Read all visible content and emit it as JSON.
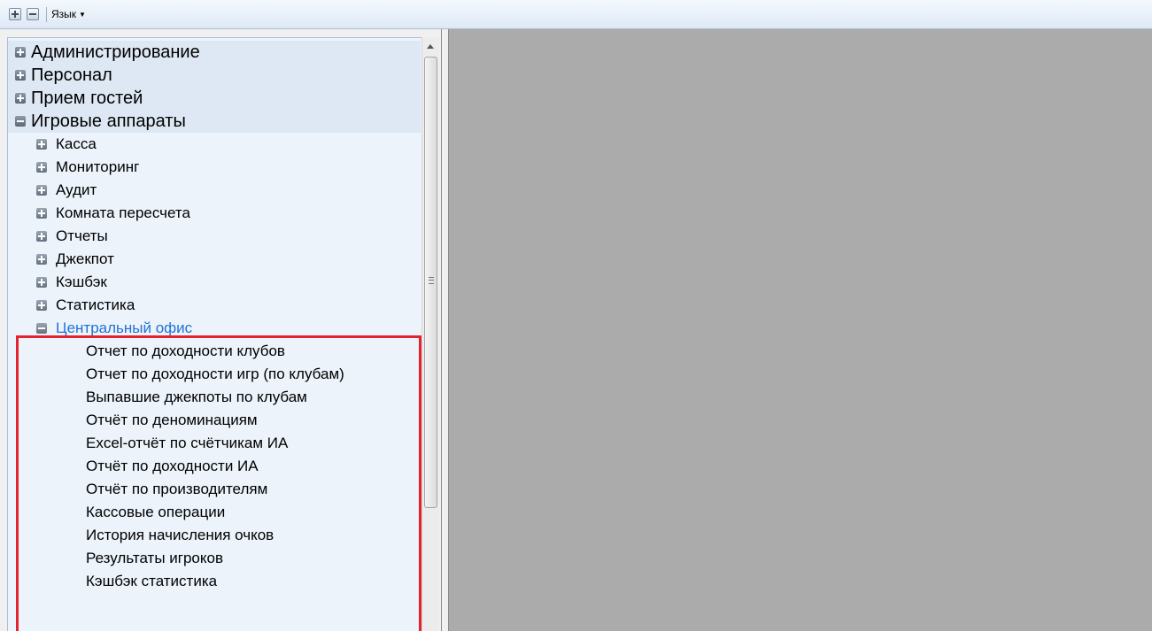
{
  "toolbar": {
    "expand_all_tooltip": "",
    "collapse_all_tooltip": "",
    "language_label": "Язык"
  },
  "tree": {
    "sections": [
      {
        "label": "Администрирование",
        "state": "collapsed"
      },
      {
        "label": "Персонал",
        "state": "collapsed"
      },
      {
        "label": "Прием гостей",
        "state": "collapsed"
      },
      {
        "label": "Игровые аппараты",
        "state": "expanded"
      }
    ],
    "game_machines_children": [
      {
        "label": "Касса",
        "state": "collapsed"
      },
      {
        "label": "Мониторинг",
        "state": "collapsed"
      },
      {
        "label": "Аудит",
        "state": "collapsed"
      },
      {
        "label": "Комната пересчета",
        "state": "collapsed"
      },
      {
        "label": "Отчеты",
        "state": "collapsed"
      },
      {
        "label": "Джекпот",
        "state": "collapsed"
      },
      {
        "label": "Кэшбэк",
        "state": "collapsed"
      },
      {
        "label": "Статистика",
        "state": "collapsed"
      },
      {
        "label": "Центральный офис",
        "state": "expanded"
      }
    ],
    "central_office_children": [
      "Отчет по доходности клубов",
      "Отчет по доходности игр (по клубам)",
      "Выпавшие джекпоты по клубам",
      "Отчёт по деноминациям",
      "Excel-отчёт по счётчикам ИА",
      "Отчёт по доходности ИА",
      "Отчёт по производителям",
      "Кассовые операции",
      "История начисления очков",
      "Результаты игроков",
      "Кэшбэк статистика"
    ]
  },
  "colors": {
    "active_item": "#1f72d6",
    "highlight_border": "#e5232f",
    "workspace_bg": "#ababab"
  }
}
